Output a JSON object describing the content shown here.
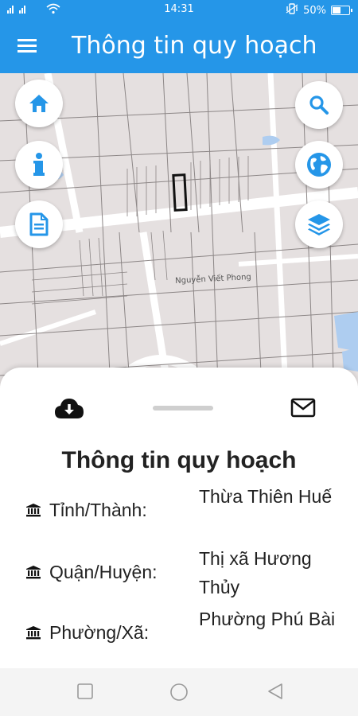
{
  "status_bar": {
    "signal": "ııl ııl",
    "time": "14:31",
    "battery_text": "50%",
    "battery_level": 0.5
  },
  "app_bar": {
    "title": "Thông tin quy hoạch",
    "menu_icon": "hamburger-menu-icon"
  },
  "map": {
    "street_label": "Nguyễn Viết Phong",
    "left_buttons": [
      "home-icon",
      "info-icon",
      "document-icon"
    ],
    "right_buttons": [
      "search-icon",
      "globe-icon",
      "layers-icon"
    ],
    "accent": "#2596e8"
  },
  "sheet": {
    "download_icon": "cloud-download-icon",
    "mail_icon": "mail-icon",
    "title": "Thông tin quy hoạch",
    "rows": [
      {
        "label": "Tỉnh/Thành:",
        "value": "Thừa Thiên Huế",
        "icon": "bank-icon"
      },
      {
        "label": "Quận/Huyện:",
        "value": "Thị xã Hương Thủy",
        "icon": "bank-icon"
      },
      {
        "label": "Phường/Xã:",
        "value": "Phường Phú Bài",
        "icon": "bank-icon"
      }
    ]
  },
  "nav_bar": {
    "buttons": [
      "recent-apps-icon",
      "home-circle-icon",
      "back-icon"
    ]
  }
}
